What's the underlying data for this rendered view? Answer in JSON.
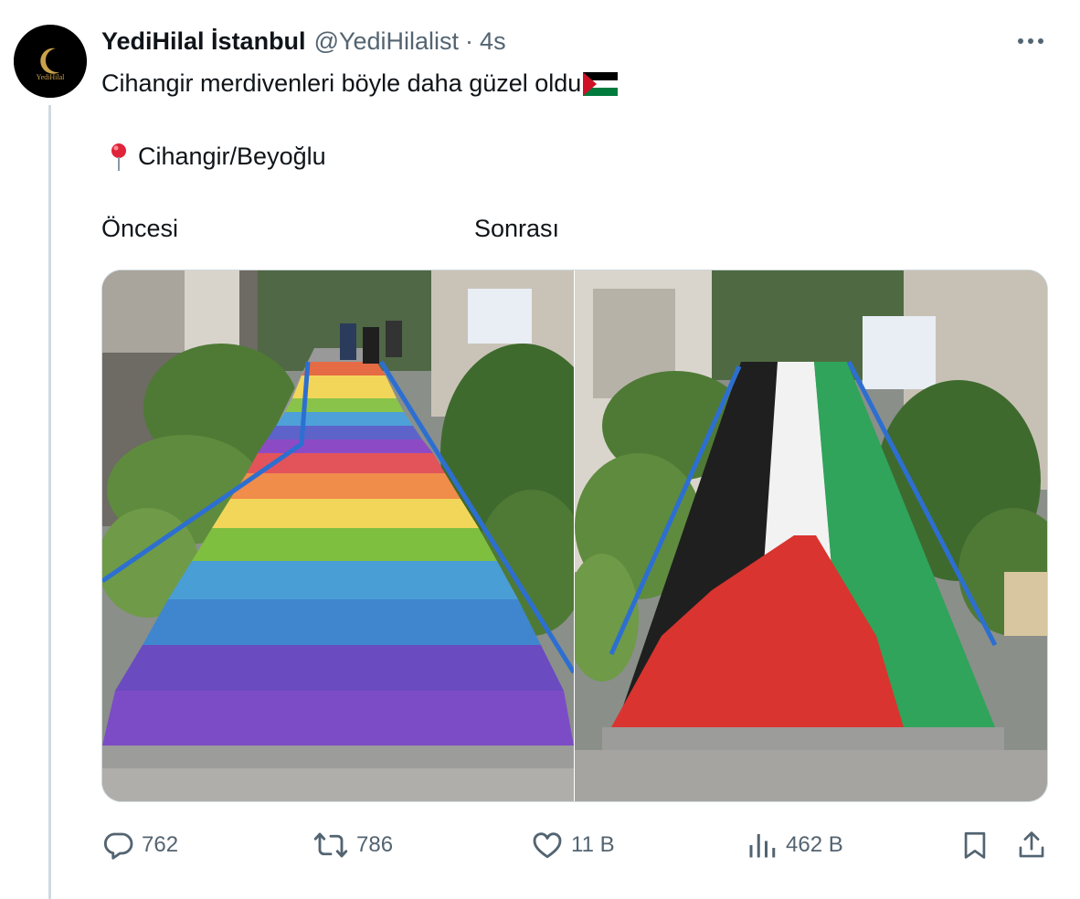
{
  "tweet": {
    "author": {
      "display_name": "YediHilal İstanbul",
      "handle": "@YediHilalist",
      "avatar_wordmark": "YediHilal"
    },
    "separator": "·",
    "time": "4s",
    "text_line1": "Cihangir merdivenleri böyle daha güzel oldu",
    "flag_emoji": "palestine-flag",
    "location_pin": "round-pushpin",
    "text_line2": "Cihangir/Beyoğlu",
    "label_before": "Öncesi",
    "label_after": "Sonrası"
  },
  "media": {
    "left_image": "rainbow-painted-stairs",
    "right_image": "palestine-flag-painted-stairs"
  },
  "actions": {
    "replies": "762",
    "reposts": "786",
    "likes": "11 B",
    "views": "462 B"
  },
  "colors": {
    "text_primary": "#0f1419",
    "text_secondary": "#536471",
    "border": "#cfd9de",
    "flag_red": "#ce1126",
    "flag_green": "#007a3d"
  }
}
